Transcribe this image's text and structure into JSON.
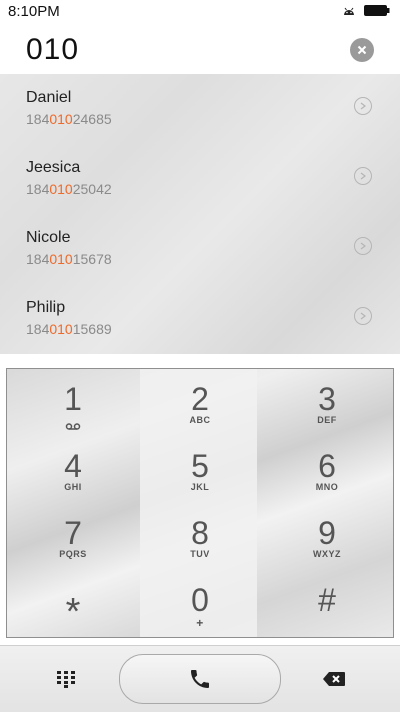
{
  "status": {
    "time": "8:10PM",
    "icons": [
      "android-icon",
      "battery-icon"
    ]
  },
  "entry": {
    "number": "010",
    "clear_icon": "clear-circle-icon"
  },
  "contacts": [
    {
      "name": "Daniel",
      "phone_pre": "184",
      "phone_match": "010",
      "phone_post": "24685"
    },
    {
      "name": "Jeesica",
      "phone_pre": "184",
      "phone_match": "010",
      "phone_post": "25042"
    },
    {
      "name": "Nicole",
      "phone_pre": "184",
      "phone_match": "010",
      "phone_post": "15678"
    },
    {
      "name": "Philip",
      "phone_pre": "184",
      "phone_match": "010",
      "phone_post": "15689"
    }
  ],
  "keys": [
    {
      "digit": "1",
      "letters": ""
    },
    {
      "digit": "2",
      "letters": "ABC"
    },
    {
      "digit": "3",
      "letters": "DEF"
    },
    {
      "digit": "4",
      "letters": "GHI"
    },
    {
      "digit": "5",
      "letters": "JKL"
    },
    {
      "digit": "6",
      "letters": "MNO"
    },
    {
      "digit": "7",
      "letters": "PQRS"
    },
    {
      "digit": "8",
      "letters": "TUV"
    },
    {
      "digit": "9",
      "letters": "WXYZ"
    },
    {
      "digit": "*",
      "letters": ""
    },
    {
      "digit": "0",
      "letters": "+"
    },
    {
      "digit": "#",
      "letters": ""
    }
  ],
  "bottom": {
    "left_icon": "keypad-grid-icon",
    "call_icon": "phone-icon",
    "right_icon": "backspace-icon"
  },
  "colors": {
    "highlight": "#ee6a2b",
    "text_primary": "#222222",
    "text_secondary": "#8a8a8a"
  }
}
